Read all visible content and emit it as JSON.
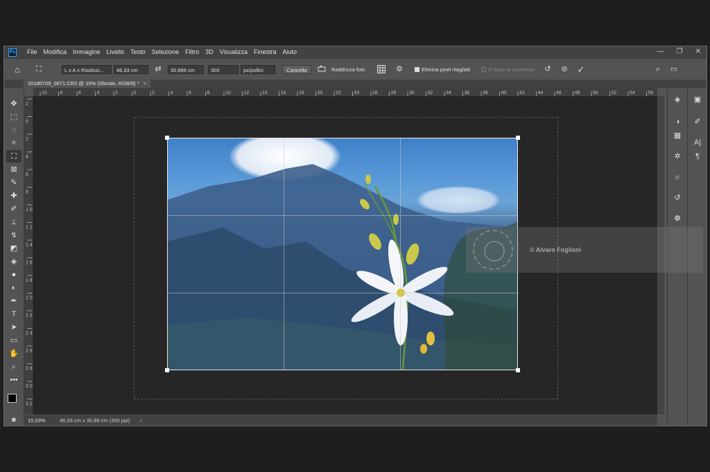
{
  "app": {
    "logo": "Ps"
  },
  "menu": [
    "File",
    "Modifica",
    "Immagine",
    "Livello",
    "Testo",
    "Selezione",
    "Filtro",
    "3D",
    "Visualizza",
    "Finestra",
    "Aiuto"
  ],
  "window_controls": {
    "minimize": "—",
    "restore": "❐",
    "close": "✕"
  },
  "options": {
    "home_icon": "⌂",
    "crop_icon": "⛶",
    "ratio_select": "L x A x Risoluzi...",
    "width_value": "46,33 cm",
    "swap_icon": "⇄",
    "height_value": "30,886 cm",
    "resolution_value": "300",
    "resolution_unit": "px/pollici",
    "cancel_label": "Cancella",
    "straighten_label": "Raddrizza foto",
    "delete_cropped_label": "Elimina pixel ritagliati",
    "content_aware_label": "In base al contenuto"
  },
  "document": {
    "tab_title": "20180709_0671.CR2 @ 15% (Sfondo, RGB/8) *",
    "close": "×"
  },
  "ruler": {
    "h_ticks": [
      "10",
      "8",
      "6",
      "4",
      "2",
      "0",
      "2",
      "4",
      "6",
      "8",
      "10",
      "12",
      "14",
      "16",
      "18",
      "20",
      "22",
      "24",
      "26",
      "28",
      "30",
      "32",
      "34",
      "36",
      "38",
      "40",
      "42",
      "44",
      "46",
      "48",
      "50",
      "52",
      "54",
      "56"
    ],
    "v_ticks": [
      "2",
      "0",
      "2",
      "4",
      "6",
      "8",
      "1 0",
      "1 2",
      "1 4",
      "1 6",
      "1 8",
      "2 0",
      "2 2",
      "2 4",
      "2 6",
      "2 8",
      "3 0",
      "3 2"
    ]
  },
  "status": {
    "zoom": "15,03%",
    "doc_info": "46,33 cm x 30,89 cm (300 ppi)",
    "arrow": "›"
  },
  "watermark": {
    "credit": "© Alvaro Foglieni"
  },
  "colors": {
    "accent": "#31a8ff",
    "chrome": "#535353",
    "canvas": "#262626"
  }
}
